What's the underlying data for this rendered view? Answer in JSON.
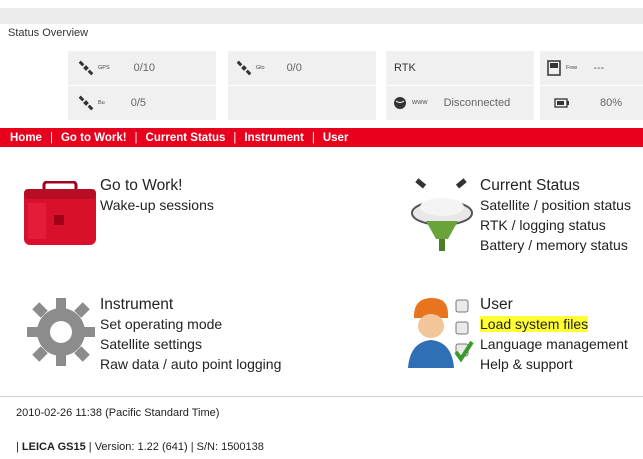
{
  "page_title": "Status Overview",
  "status": {
    "gps_label": "GPS",
    "gps_value": "0/10",
    "glo_label": "Glo",
    "glo_value": "0/0",
    "rtk_label": "RTK",
    "free_label": "Free",
    "free_value": "---",
    "bu_label": "Bu",
    "bu_value": "0/5",
    "www_label": "WWW",
    "www_value": "Disconnected",
    "battery_value": "80%"
  },
  "nav": {
    "items": [
      "Home",
      "Go to Work!",
      "Current Status",
      "Instrument",
      "User"
    ],
    "separator": "|"
  },
  "panels": {
    "work": {
      "title": "Go to Work!",
      "links": [
        "Wake-up sessions"
      ]
    },
    "status": {
      "title": "Current Status",
      "links": [
        "Satellite / position status",
        "RTK / logging status",
        "Battery / memory status"
      ]
    },
    "instrument": {
      "title": "Instrument",
      "links": [
        "Set operating mode",
        "Satellite settings",
        "Raw data / auto point logging"
      ]
    },
    "user": {
      "title": "User",
      "links": [
        "Load system files",
        "Language management",
        "Help & support"
      ]
    }
  },
  "footer": {
    "datetime": "2010-02-26 11:38 (Pacific Standard Time)",
    "product": "LEICA GS15",
    "version": "Version: 1.22 (641)",
    "serial": "S/N: 1500138"
  },
  "colors": {
    "nav_bg": "#e8001c",
    "highlight": "#ffff33",
    "cell_bg": "#f0f0f0"
  }
}
